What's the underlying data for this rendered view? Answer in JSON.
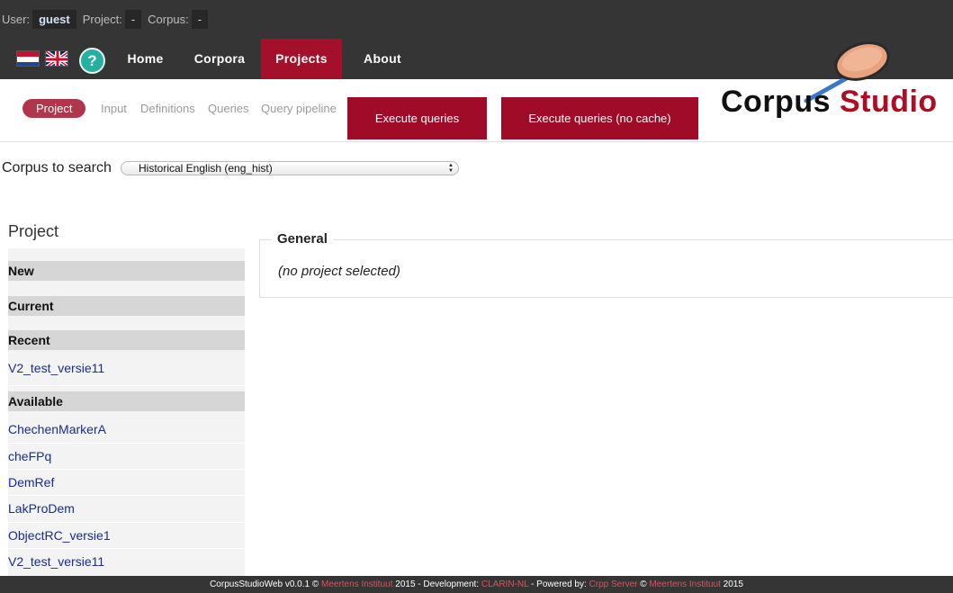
{
  "status": {
    "user_label": "User:",
    "user_value": "guest",
    "project_label": "Project:",
    "project_value": "-",
    "corpus_label": "Corpus:",
    "corpus_value": "-"
  },
  "nav": {
    "home": "Home",
    "corpora": "Corpora",
    "projects": "Projects",
    "about": "About",
    "help_glyph": "?"
  },
  "logo": {
    "word1": "Corpus",
    "word2": "Studio"
  },
  "subnav": {
    "project": "Project",
    "input": "Input",
    "definitions": "Definitions",
    "queries": "Queries",
    "query_pipeline": "Query pipeline",
    "execute": "Execute queries",
    "execute_nocache": "Execute queries (no cache)"
  },
  "corpus_search": {
    "label": "Corpus to search",
    "selected": "Historical English (eng_hist)"
  },
  "sidebar": {
    "title": "Project",
    "new_header": "New",
    "current_header": "Current",
    "recent_header": "Recent",
    "recent": [
      "V2_test_versie11"
    ],
    "available_header": "Available",
    "available": [
      "ChechenMarkerA",
      "cheFPq",
      "DemRef",
      "LakProDem",
      "ObjectRC_versie1",
      "V2_test_versie11"
    ]
  },
  "general": {
    "legend": "General",
    "body": "(no project selected)"
  },
  "footer": {
    "part1": "CorpusStudioWeb v0.0.1 © ",
    "meertens1": "Meertens Instituut",
    "part2": " 2015 - Development: ",
    "clarin": "CLARIN-NL",
    "part3": " - Powered by: ",
    "crpp": "Crpp Server",
    "part4": " © ",
    "meertens2": "Meertens Instituut",
    "part5": " 2015"
  },
  "colors": {
    "accent": "#a00c28",
    "dark": "#353535",
    "link": "#1a2c8a"
  }
}
